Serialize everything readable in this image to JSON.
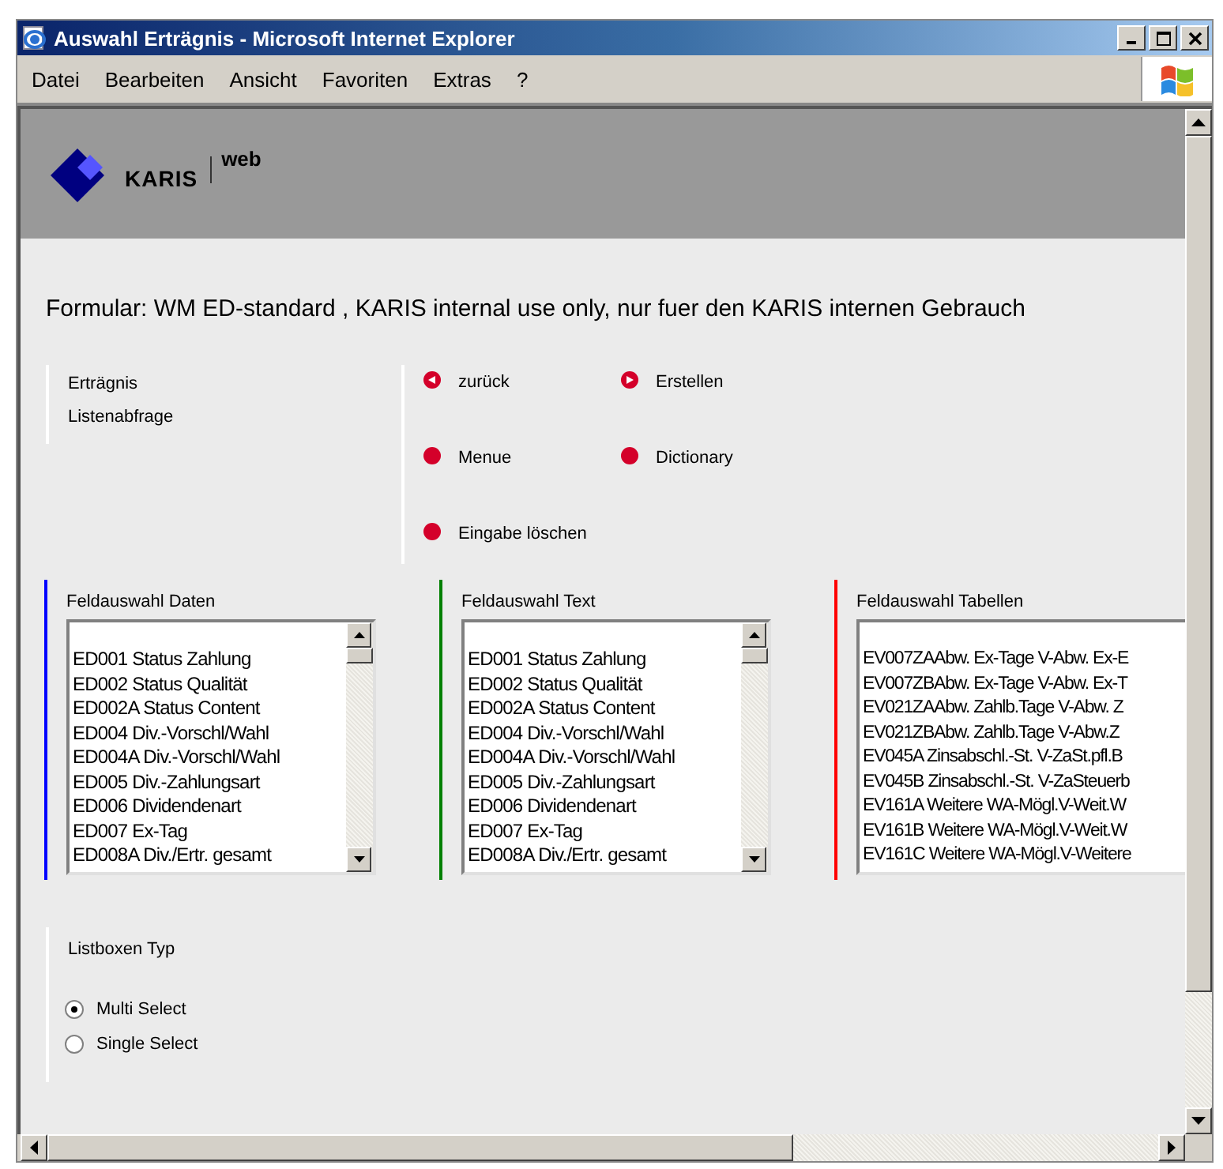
{
  "window": {
    "title": "Auswahl Erträgnis - Microsoft Internet Explorer"
  },
  "menu": [
    "Datei",
    "Bearbeiten",
    "Ansicht",
    "Favoriten",
    "Extras",
    "?"
  ],
  "header": {
    "brand": "KARIS",
    "sub": "web"
  },
  "form_title": "Formular: WM ED-standard , KARIS internal use only, nur fuer den KARIS internen Gebrauch",
  "info": [
    "Erträgnis",
    "Listenabfrage"
  ],
  "actions": [
    {
      "label": "zurück",
      "kind": "back"
    },
    {
      "label": "Erstellen",
      "kind": "forward"
    },
    {
      "label": "Menue",
      "kind": "dot"
    },
    {
      "label": "Dictionary",
      "kind": "dot"
    },
    {
      "label": "Eingabe löschen",
      "kind": "dot"
    }
  ],
  "listboxes": [
    {
      "label": "Feldauswahl Daten",
      "color": "#0000ff",
      "scrollbar": true,
      "items": [
        "ED001 Status Zahlung",
        "ED002 Status Qualität",
        "ED002A Status Content",
        "ED004 Div.-Vorschl/Wahl",
        "ED004A Div.-Vorschl/Wahl",
        "ED005 Div.-Zahlungsart",
        "ED006 Dividendenart",
        "ED007 Ex-Tag",
        "ED008A Div./Ertr. gesamt"
      ]
    },
    {
      "label": "Feldauswahl Text",
      "color": "#008000",
      "scrollbar": true,
      "items": [
        "ED001 Status Zahlung",
        "ED002 Status Qualität",
        "ED002A Status Content",
        "ED004 Div.-Vorschl/Wahl",
        "ED004A Div.-Vorschl/Wahl",
        "ED005 Div.-Zahlungsart",
        "ED006 Dividendenart",
        "ED007 Ex-Tag",
        "ED008A Div./Ertr. gesamt"
      ]
    },
    {
      "label": "Feldauswahl Tabellen",
      "color": "#ff0000",
      "scrollbar": false,
      "items": [
        "EV007ZAAbw. Ex-Tage V-Abw. Ex-E",
        "EV007ZBAbw. Ex-Tage V-Abw. Ex-T",
        "EV021ZAAbw. Zahlb.Tage V-Abw. Z",
        "EV021ZBAbw. Zahlb.Tage V-Abw.Z",
        "EV045A Zinsabschl.-St. V-ZaSt.pfl.B",
        "EV045B Zinsabschl.-St. V-ZaSteuerb",
        "EV161A Weitere WA-Mögl.V-Weit.W",
        "EV161B Weitere WA-Mögl.V-Weit.W",
        "EV161C Weitere WA-Mögl.V-Weitere"
      ]
    }
  ],
  "listbox_type": {
    "label": "Listboxen Typ",
    "options": [
      {
        "label": "Multi Select",
        "selected": true
      },
      {
        "label": "Single Select",
        "selected": false
      }
    ]
  }
}
